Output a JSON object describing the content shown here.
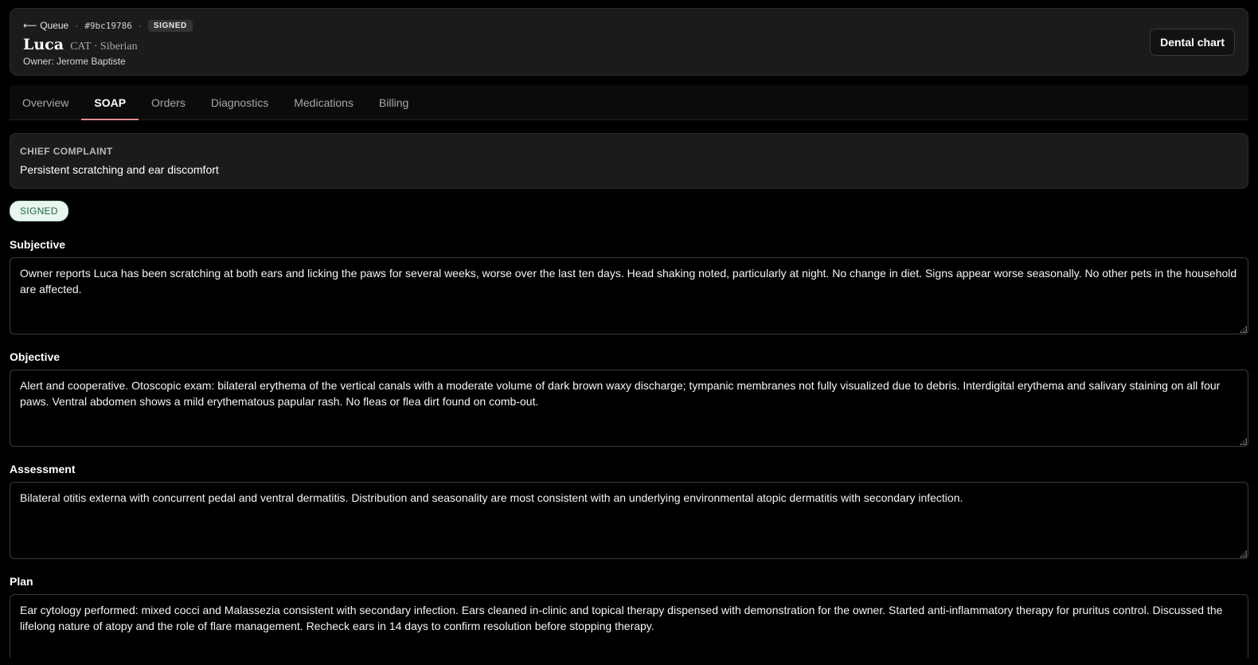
{
  "header": {
    "back_arrow": "⟵",
    "back_label": "Queue",
    "separator": "·",
    "record_id": "#9bc19786",
    "status_badge": "SIGNED",
    "pet_name": "Luca",
    "pet_species": "CAT · Siberian",
    "owner": "Owner: Jerome Baptiste",
    "dental_chart_button": "Dental chart"
  },
  "tabs": [
    {
      "label": "Overview",
      "active": false
    },
    {
      "label": "SOAP",
      "active": true
    },
    {
      "label": "Orders",
      "active": false
    },
    {
      "label": "Diagnostics",
      "active": false
    },
    {
      "label": "Medications",
      "active": false
    },
    {
      "label": "Billing",
      "active": false
    }
  ],
  "chief_complaint": {
    "label": "CHIEF COMPLAINT",
    "text": "Persistent scratching and ear discomfort"
  },
  "status_pill": "SIGNED",
  "soap": {
    "subjective": {
      "label": "Subjective",
      "text": "Owner reports Luca has been scratching at both ears and licking the paws for several weeks, worse over the last ten days. Head shaking noted, particularly at night. No change in diet. Signs appear worse seasonally. No other pets in the household are affected."
    },
    "objective": {
      "label": "Objective",
      "text": "Alert and cooperative. Otoscopic exam: bilateral erythema of the vertical canals with a moderate volume of dark brown waxy discharge; tympanic membranes not fully visualized due to debris. Interdigital erythema and salivary staining on all four paws. Ventral abdomen shows a mild erythematous papular rash. No fleas or flea dirt found on comb-out."
    },
    "assessment": {
      "label": "Assessment",
      "text": "Bilateral otitis externa with concurrent pedal and ventral dermatitis. Distribution and seasonality are most consistent with an underlying environmental atopic dermatitis with secondary infection."
    },
    "plan": {
      "label": "Plan",
      "text": "Ear cytology performed: mixed cocci and Malassezia consistent with secondary infection. Ears cleaned in-clinic and topical therapy dispensed with demonstration for the owner. Started anti-inflammatory therapy for pruritus control. Discussed the lifelong nature of atopy and the role of flare management. Recheck ears in 14 days to confirm resolution before stopping therapy."
    }
  },
  "colors": {
    "background": "#000000",
    "card": "#1b1b1b",
    "active_tab_underline": "#e38b8b",
    "signed_pill_bg": "#e9f6ef",
    "signed_pill_text": "#1d6b45"
  }
}
